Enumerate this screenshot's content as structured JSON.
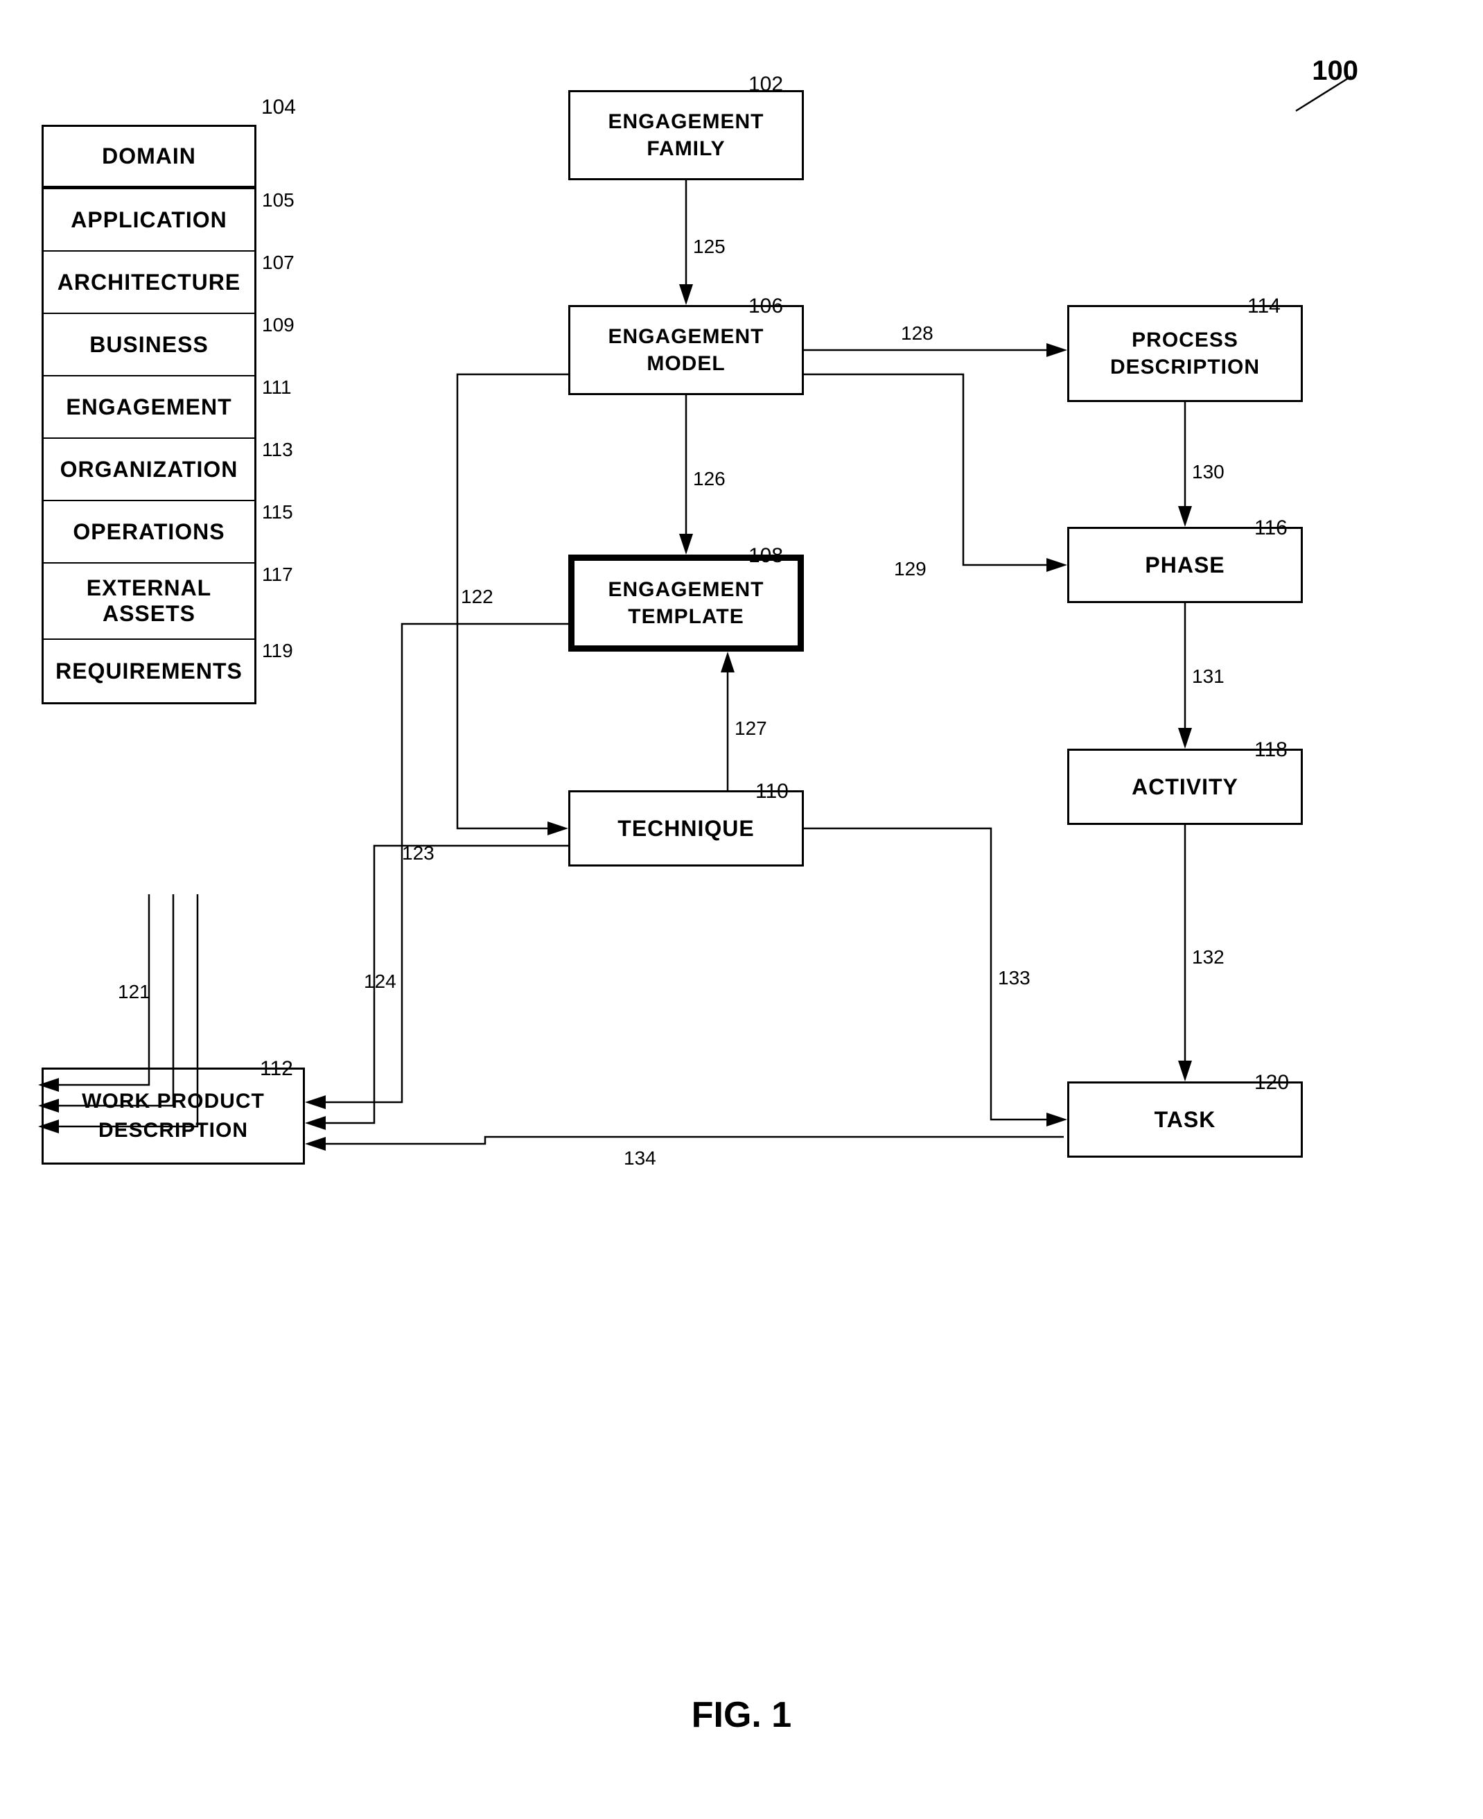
{
  "diagram": {
    "title": "FIG. 1",
    "reference_number": "100",
    "nodes": {
      "engagement_family": {
        "label": "ENGAGEMENT\nFAMILY",
        "ref": "102"
      },
      "engagement_model": {
        "label": "ENGAGEMENT\nMODEL",
        "ref": "106"
      },
      "engagement_template": {
        "label": "ENGAGEMENT\nTEMPLATE",
        "ref": "108"
      },
      "technique": {
        "label": "TECHNIQUE",
        "ref": "110"
      },
      "work_product": {
        "label": "WORK PRODUCT\nDESCRIPTION",
        "ref": "112"
      },
      "process_description": {
        "label": "PROCESS\nDESCRIPTION",
        "ref": "114"
      },
      "phase": {
        "label": "PHASE",
        "ref": "116"
      },
      "activity": {
        "label": "ACTIVITY",
        "ref": "118"
      },
      "task": {
        "label": "TASK",
        "ref": "120"
      }
    },
    "category_list": {
      "ref": "104",
      "items": [
        {
          "label": "DOMAIN",
          "ref": "105",
          "thick": true
        },
        {
          "label": "APPLICATION",
          "ref": "107"
        },
        {
          "label": "ARCHITECTURE",
          "ref": "109"
        },
        {
          "label": "BUSINESS",
          "ref": "111"
        },
        {
          "label": "ENGAGEMENT",
          "ref": "113"
        },
        {
          "label": "ORGANIZATION",
          "ref": "115"
        },
        {
          "label": "OPERATIONS",
          "ref": "117"
        },
        {
          "label": "EXTERNAL\nASSETS",
          "ref": "119"
        },
        {
          "label": "REQUIREMENTS",
          "ref": ""
        }
      ]
    },
    "arrows": [
      {
        "id": "125",
        "from": "engagement_family",
        "to": "engagement_model",
        "label": "125"
      },
      {
        "id": "126",
        "from": "engagement_model",
        "to": "engagement_template",
        "label": "126"
      },
      {
        "id": "128",
        "from": "engagement_model",
        "to": "process_description",
        "label": "128"
      },
      {
        "id": "129",
        "from": "engagement_model",
        "to": "phase",
        "label": "129"
      },
      {
        "id": "130",
        "from": "process_description",
        "to": "phase",
        "label": "130"
      },
      {
        "id": "127",
        "from": "technique",
        "to": "engagement_template",
        "label": "127"
      },
      {
        "id": "131",
        "from": "phase",
        "to": "activity",
        "label": "131"
      },
      {
        "id": "132",
        "from": "activity",
        "to": "task",
        "label": "132"
      },
      {
        "id": "133",
        "from": "technique",
        "to": "task",
        "label": "133"
      },
      {
        "id": "134",
        "from": "task",
        "to": "work_product",
        "label": "134"
      },
      {
        "id": "122",
        "from": "engagement_model",
        "to": "technique",
        "label": "122"
      },
      {
        "id": "123",
        "from": "engagement_template",
        "to": "work_product",
        "label": "123"
      },
      {
        "id": "124",
        "from": "technique",
        "to": "work_product",
        "label": "124"
      },
      {
        "id": "121",
        "from": "category_list",
        "to": "work_product",
        "label": "121"
      }
    ]
  }
}
